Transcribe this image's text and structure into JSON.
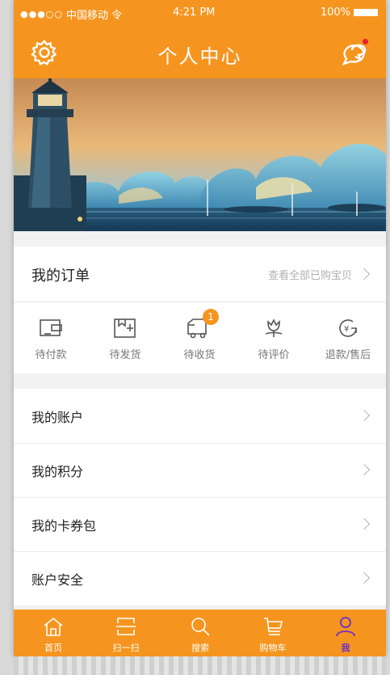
{
  "status_bar": {
    "signal": "●●●○○",
    "carrier": "中国移动",
    "wifi": "令",
    "time": "4:21 PM",
    "battery": "100%"
  },
  "nav": {
    "title": "个人中心",
    "settings_icon": "gear-icon",
    "message_icon": "chat-bubble-icon"
  },
  "orders": {
    "title": "我的订单",
    "view_all": "查看全部已购宝贝",
    "statuses": [
      {
        "label": "待付款",
        "icon": "wallet-icon"
      },
      {
        "label": "待发货",
        "icon": "package-icon"
      },
      {
        "label": "待收货",
        "icon": "truck-icon",
        "badge": "1"
      },
      {
        "label": "待评价",
        "icon": "flower-icon"
      },
      {
        "label": "退款/售后",
        "icon": "refund-icon"
      }
    ]
  },
  "menu": [
    {
      "label": "我的账户"
    },
    {
      "label": "我的积分"
    },
    {
      "label": "我的卡券包"
    },
    {
      "label": "账户安全"
    }
  ],
  "tabs": [
    {
      "label": "首页",
      "icon": "home-icon"
    },
    {
      "label": "扫一扫",
      "icon": "scan-icon"
    },
    {
      "label": "搜索",
      "icon": "search-icon"
    },
    {
      "label": "购物车",
      "icon": "cart-icon"
    },
    {
      "label": "我",
      "icon": "user-icon",
      "active": true
    }
  ],
  "colors": {
    "brand": "#f5951f",
    "badge": "#f5951f",
    "notification_dot": "#e8212b",
    "active_tab": "#6a2fc9"
  }
}
